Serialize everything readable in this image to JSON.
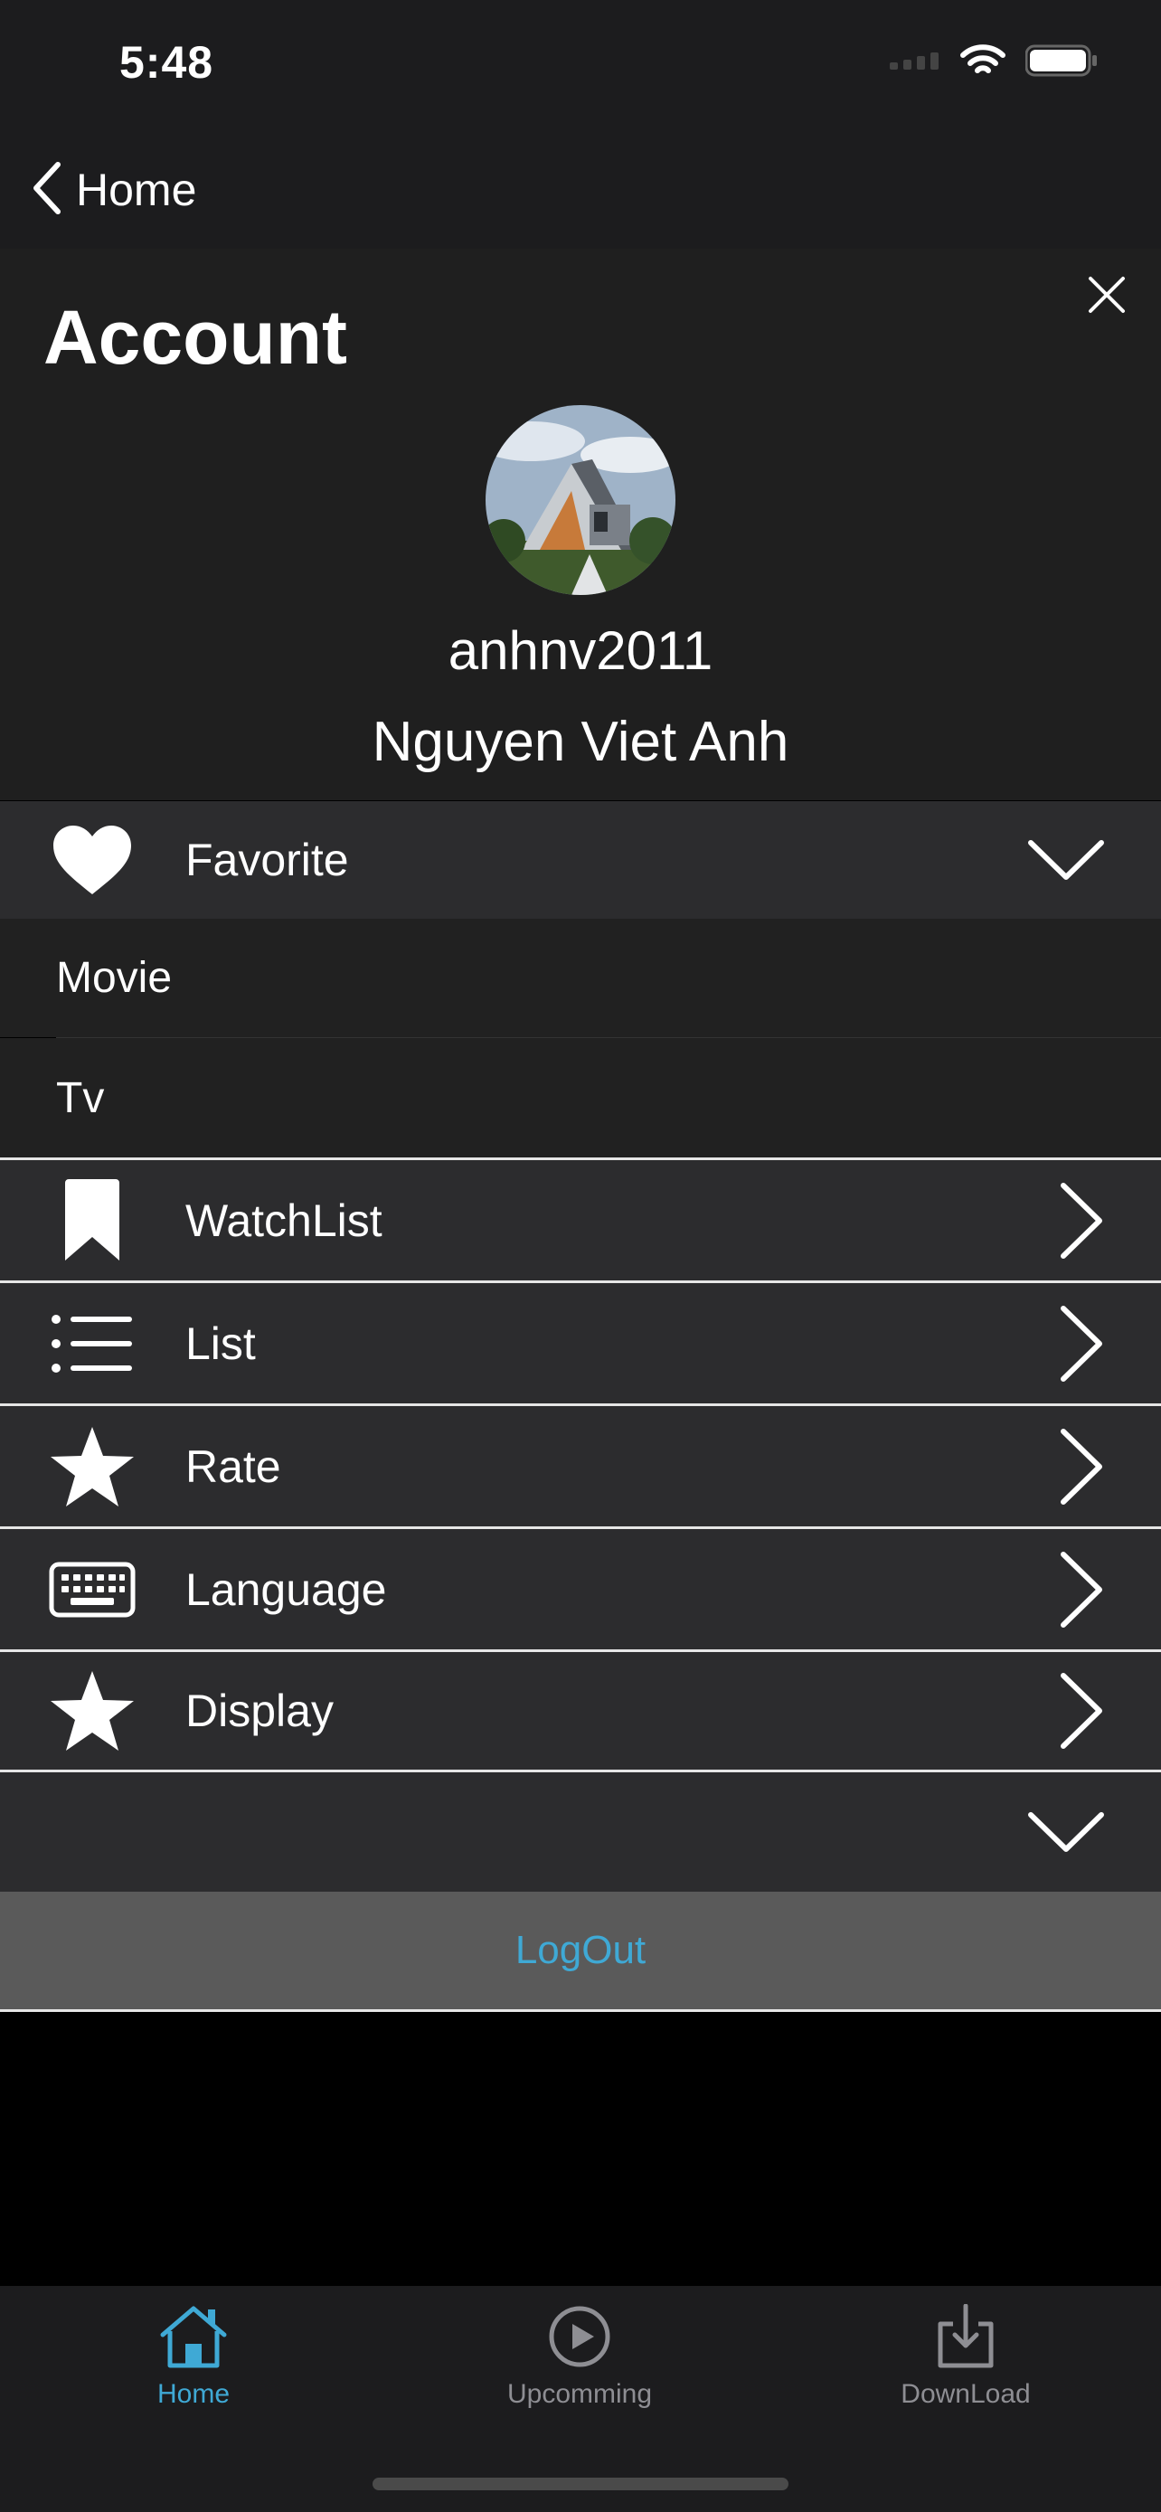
{
  "status_bar": {
    "time": "5:48"
  },
  "nav": {
    "back_label": "Home"
  },
  "account": {
    "title": "Account",
    "username": "anhnv2011",
    "full_name": "Nguyen Viet Anh"
  },
  "favorite": {
    "label": "Favorite",
    "icon": "heart-icon",
    "expanded": true,
    "sub_items": [
      "Movie",
      "Tv"
    ]
  },
  "menu": [
    {
      "label": "WatchList",
      "icon": "bookmark-icon"
    },
    {
      "label": "List",
      "icon": "list-icon"
    },
    {
      "label": "Rate",
      "icon": "star-icon"
    },
    {
      "label": "Language",
      "icon": "keyboard-icon"
    },
    {
      "label": "Display",
      "icon": "star-icon"
    }
  ],
  "logout_label": "LogOut",
  "tabs": [
    {
      "label": "Home",
      "icon": "house-icon",
      "active": true
    },
    {
      "label": "Upcomming",
      "icon": "play-circle-icon",
      "active": false
    },
    {
      "label": "DownLoad",
      "icon": "download-icon",
      "active": false
    }
  ],
  "colors": {
    "accent": "#3fa9d5",
    "row_background": "#2c2c2e",
    "logout_background": "#5a5a5a"
  }
}
